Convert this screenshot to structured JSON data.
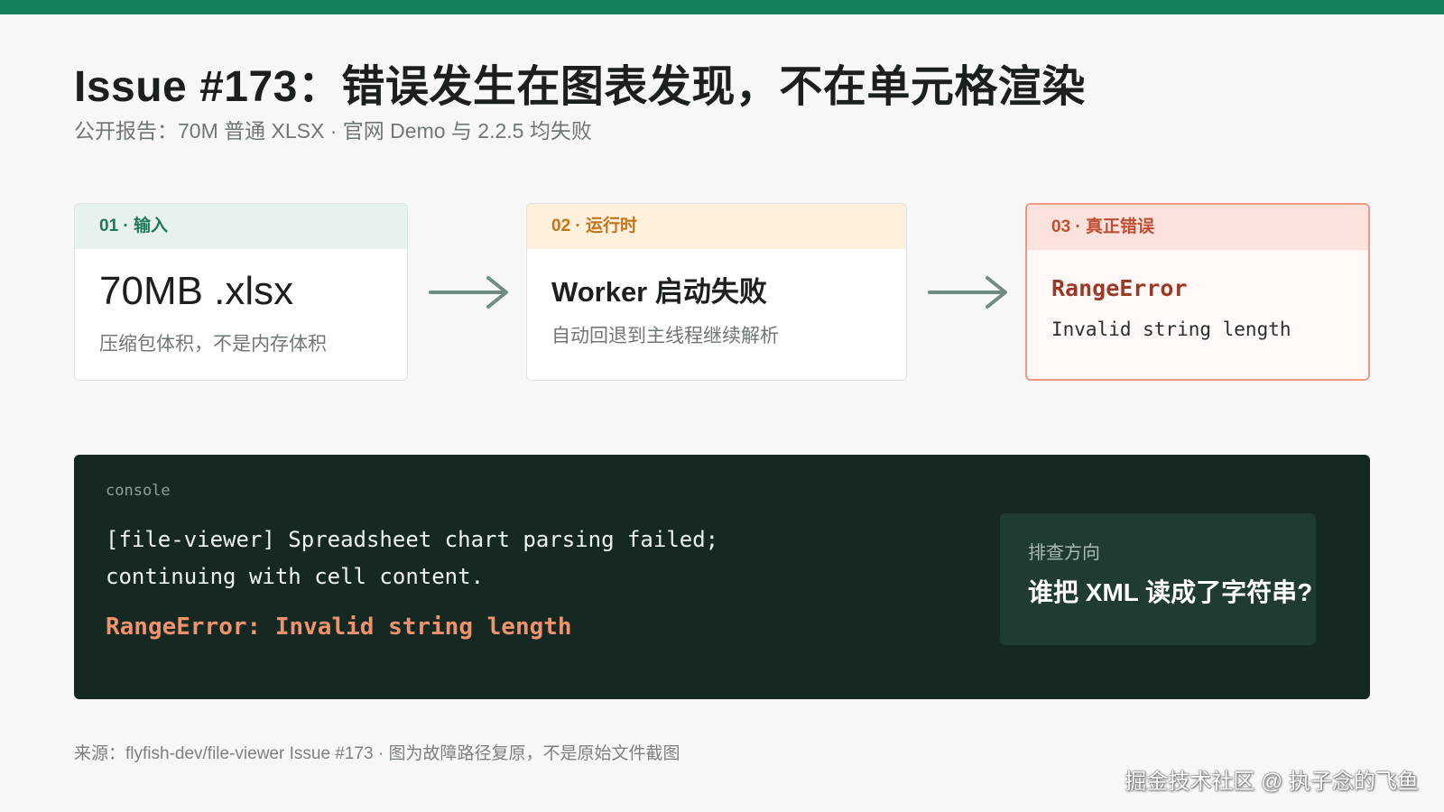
{
  "header": {
    "title": "Issue #173：错误发生在图表发现，不在单元格渲染",
    "subtitle": "公开报告：70M 普通 XLSX · 官网 Demo 与 2.2.5 均失败"
  },
  "steps": [
    {
      "label": "01 · 输入",
      "main": "70MB .xlsx",
      "sub": "压缩包体积，不是内存体积"
    },
    {
      "label": "02 · 运行时",
      "main": "Worker 启动失败",
      "sub": "自动回退到主线程继续解析"
    },
    {
      "label": "03 · 真正错误",
      "main": "RangeError",
      "sub": "Invalid string length"
    }
  ],
  "console": {
    "label": "console",
    "line1": "[file-viewer] Spreadsheet chart parsing failed;",
    "line2": "continuing with cell content.",
    "error": "RangeError: Invalid string length"
  },
  "hint": {
    "label": "排查方向",
    "text": "谁把 XML 读成了字符串?"
  },
  "footer": "来源：flyfish-dev/file-viewer Issue #173 · 图为故障路径复原，不是原始文件截图",
  "watermark": "掘金技术社区 @ 执子念的飞鱼",
  "colors": {
    "accent": "#17805f",
    "console_bg": "#152822",
    "error": "#f2926d",
    "arrow": "#6f8c80"
  },
  "icons": [
    "right-arrow-icon",
    "right-arrow-icon"
  ]
}
